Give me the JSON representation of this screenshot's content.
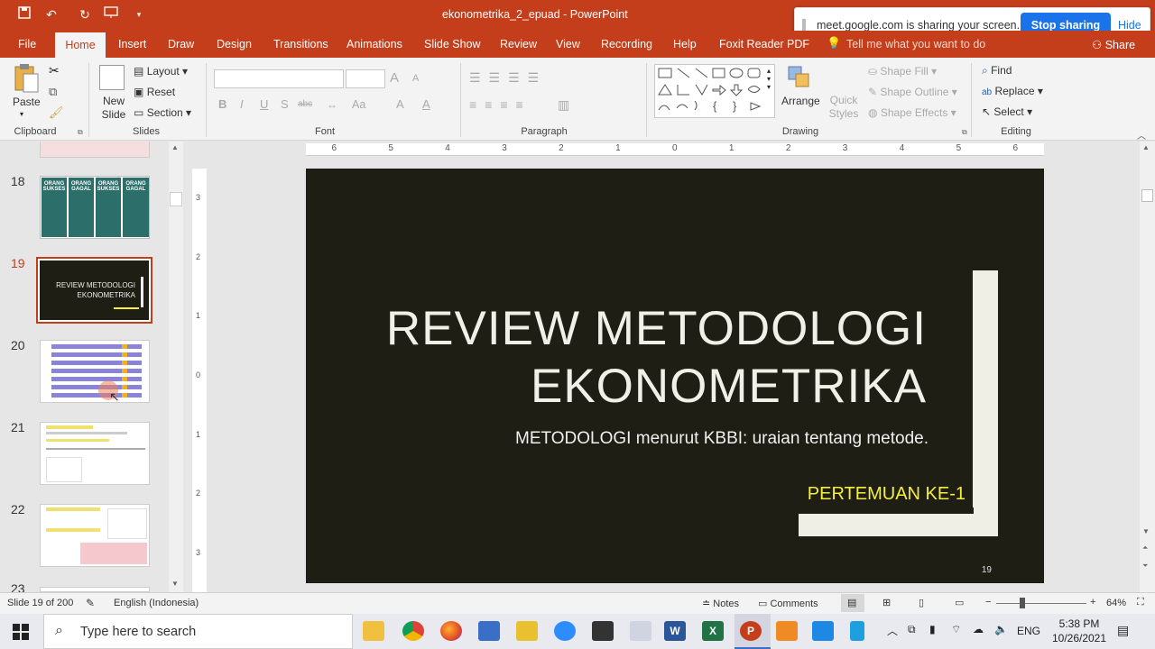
{
  "window": {
    "title": "ekonometrika_2_epuad - PowerPoint"
  },
  "tabs": [
    "File",
    "Home",
    "Insert",
    "Draw",
    "Design",
    "Transitions",
    "Animations",
    "Slide Show",
    "Review",
    "View",
    "Recording",
    "Help",
    "Foxit Reader PDF"
  ],
  "active_tab": "Home",
  "tell_me": "Tell me what you want to do",
  "share_label": "Share",
  "screen_share": {
    "message": "meet.google.com is sharing your screen.",
    "stop": "Stop sharing",
    "hide": "Hide"
  },
  "ribbon": {
    "clipboard": {
      "paste": "Paste",
      "label": "Clipboard"
    },
    "slides": {
      "new_slide": "New Slide",
      "layout": "Layout",
      "reset": "Reset",
      "section": "Section",
      "label": "Slides"
    },
    "font": {
      "label": "Font",
      "bold": "B",
      "italic": "I",
      "underline": "U",
      "shadow": "S",
      "strike": "abc",
      "grow": "A",
      "shrink": "A",
      "case": "Aa",
      "clear": "A"
    },
    "paragraph": {
      "label": "Paragraph"
    },
    "drawing": {
      "arrange": "Arrange",
      "quick_styles": "Quick Styles",
      "shape_fill": "Shape Fill",
      "shape_outline": "Shape Outline",
      "shape_effects": "Shape Effects",
      "label": "Drawing"
    },
    "editing": {
      "find": "Find",
      "replace": "Replace",
      "select": "Select",
      "label": "Editing"
    }
  },
  "ruler_h": [
    "6",
    "5",
    "4",
    "3",
    "2",
    "1",
    "0",
    "1",
    "2",
    "3",
    "4",
    "5",
    "6"
  ],
  "ruler_v": [
    "3",
    "2",
    "1",
    "0",
    "1",
    "2",
    "3"
  ],
  "thumbnails": [
    {
      "number": "18"
    },
    {
      "number": "19",
      "title1": "REVIEW METODOLOGI",
      "title2": "EKONOMETRIKA",
      "selected": true
    },
    {
      "number": "20"
    },
    {
      "number": "21"
    },
    {
      "number": "22"
    },
    {
      "number": "23"
    }
  ],
  "thumb18_labels": [
    "ORANG SUKSES",
    "ORANG GAGAL",
    "ORANG SUKSES",
    "ORANG GAGAL"
  ],
  "slide": {
    "title_line1": "REVIEW METODOLOGI",
    "title_line2": "EKONOMETRIKA",
    "subtitle": "METODOLOGI menurut KBBI: uraian tentang metode.",
    "meeting": "PERTEMUAN KE-1",
    "page_number": "19",
    "colors": {
      "background": "#1e1e14",
      "accent_shape": "#efefe6",
      "meeting_text": "#f5ee3a"
    }
  },
  "status": {
    "slide_info": "Slide 19 of 200",
    "language": "English (Indonesia)",
    "notes": "Notes",
    "comments": "Comments",
    "zoom": "64%"
  },
  "taskbar": {
    "search_placeholder": "Type here to search",
    "lang": "ENG",
    "time": "5:38 PM",
    "date": "10/26/2021"
  }
}
